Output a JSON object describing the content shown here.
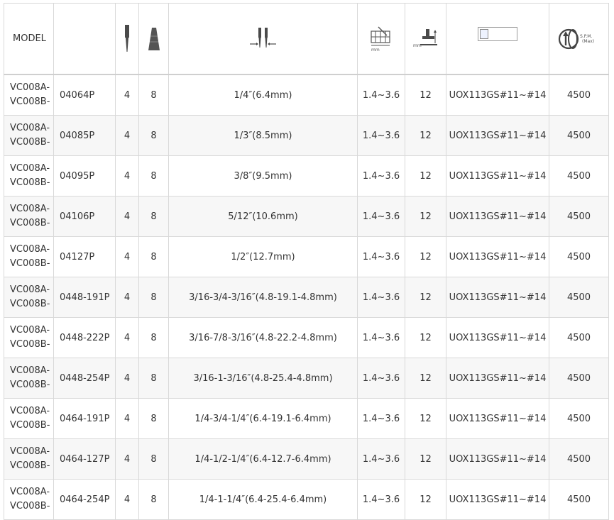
{
  "table": {
    "header": {
      "model_label": "MODEL",
      "spm_text": "S.P.M.",
      "spm_sub": "(Max)",
      "mm_label": "mm",
      "mm_label_2": "mm"
    },
    "icons": {
      "needle": "needle-icon",
      "thread": "thread-cone-icon",
      "gauge": "needle-gauge-icon",
      "stitch_length": "stitch-length-icon",
      "presser_lift": "presser-foot-lift-icon",
      "needle_system": "broken-image-icon",
      "speed": "speed-gauge-icon"
    },
    "rows": [
      {
        "model_a": "VC008A-",
        "model_b": "VC008B-",
        "part": "04064P",
        "needles": "4",
        "threads": "8",
        "gauge": "1/4″(6.4mm)",
        "stitch": "1.4~3.6",
        "lift": "12",
        "needle_system": "UOX113GS#11~#14",
        "speed": "4500"
      },
      {
        "model_a": "VC008A-",
        "model_b": "VC008B-",
        "part": "04085P",
        "needles": "4",
        "threads": "8",
        "gauge": "1/3″(8.5mm)",
        "stitch": "1.4~3.6",
        "lift": "12",
        "needle_system": "UOX113GS#11~#14",
        "speed": "4500"
      },
      {
        "model_a": "VC008A-",
        "model_b": "VC008B-",
        "part": "04095P",
        "needles": "4",
        "threads": "8",
        "gauge": "3/8″(9.5mm)",
        "stitch": "1.4~3.6",
        "lift": "12",
        "needle_system": "UOX113GS#11~#14",
        "speed": "4500"
      },
      {
        "model_a": "VC008A-",
        "model_b": "VC008B-",
        "part": "04106P",
        "needles": "4",
        "threads": "8",
        "gauge": "5/12″(10.6mm)",
        "stitch": "1.4~3.6",
        "lift": "12",
        "needle_system": "UOX113GS#11~#14",
        "speed": "4500"
      },
      {
        "model_a": "VC008A-",
        "model_b": "VC008B-",
        "part": "04127P",
        "needles": "4",
        "threads": "8",
        "gauge": "1/2″(12.7mm)",
        "stitch": "1.4~3.6",
        "lift": "12",
        "needle_system": "UOX113GS#11~#14",
        "speed": "4500"
      },
      {
        "model_a": "VC008A-",
        "model_b": "VC008B-",
        "part": "0448-191P",
        "needles": "4",
        "threads": "8",
        "gauge": "3/16-3/4-3/16″(4.8-19.1-4.8mm)",
        "stitch": "1.4~3.6",
        "lift": "12",
        "needle_system": "UOX113GS#11~#14",
        "speed": "4500"
      },
      {
        "model_a": "VC008A-",
        "model_b": "VC008B-",
        "part": "0448-222P",
        "needles": "4",
        "threads": "8",
        "gauge": "3/16-7/8-3/16″(4.8-22.2-4.8mm)",
        "stitch": "1.4~3.6",
        "lift": "12",
        "needle_system": "UOX113GS#11~#14",
        "speed": "4500"
      },
      {
        "model_a": "VC008A-",
        "model_b": "VC008B-",
        "part": "0448-254P",
        "needles": "4",
        "threads": "8",
        "gauge": "3/16-1-3/16″(4.8-25.4-4.8mm)",
        "stitch": "1.4~3.6",
        "lift": "12",
        "needle_system": "UOX113GS#11~#14",
        "speed": "4500"
      },
      {
        "model_a": "VC008A-",
        "model_b": "VC008B-",
        "part": "0464-191P",
        "needles": "4",
        "threads": "8",
        "gauge": "1/4-3/4-1/4″(6.4-19.1-6.4mm)",
        "stitch": "1.4~3.6",
        "lift": "12",
        "needle_system": "UOX113GS#11~#14",
        "speed": "4500"
      },
      {
        "model_a": "VC008A-",
        "model_b": "VC008B-",
        "part": "0464-127P",
        "needles": "4",
        "threads": "8",
        "gauge": "1/4-1/2-1/4″(6.4-12.7-6.4mm)",
        "stitch": "1.4~3.6",
        "lift": "12",
        "needle_system": "UOX113GS#11~#14",
        "speed": "4500"
      },
      {
        "model_a": "VC008A-",
        "model_b": "VC008B-",
        "part": "0464-254P",
        "needles": "4",
        "threads": "8",
        "gauge": "1/4-1-1/4″(6.4-25.4-6.4mm)",
        "stitch": "1.4~3.6",
        "lift": "12",
        "needle_system": "UOX113GS#11~#14",
        "speed": "4500"
      }
    ]
  }
}
